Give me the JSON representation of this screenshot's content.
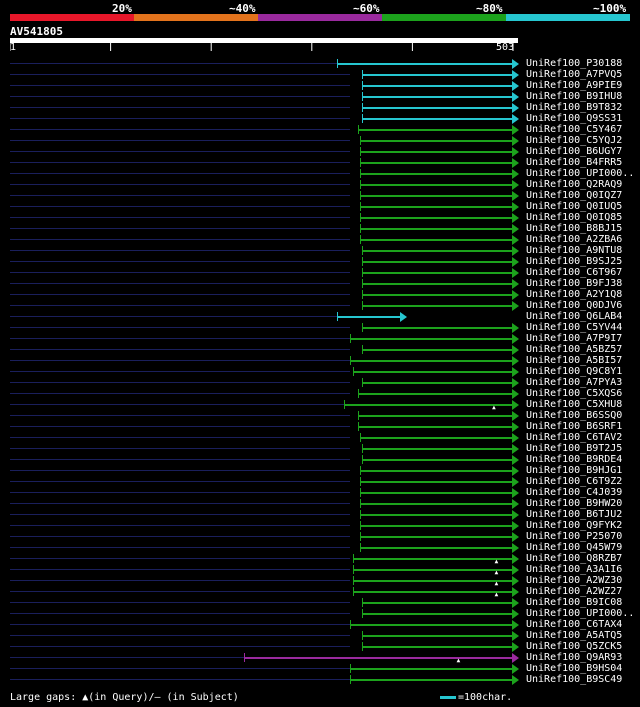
{
  "identity_legend": {
    "labels": [
      "20%",
      "~40%",
      "~60%",
      "~80%",
      "~100%"
    ],
    "colors": [
      "#e8172a",
      "#e3731c",
      "#9a2a9e",
      "#1ca21c",
      "#26c6d0"
    ]
  },
  "query": {
    "name": "AV541805",
    "start": "1",
    "end": "503"
  },
  "hits": [
    {
      "id": "UniRef100_P30188",
      "start": 0.643,
      "color": "#26c6d0"
    },
    {
      "id": "UniRef100_A7PVQ5",
      "start": 0.693,
      "color": "#26c6d0"
    },
    {
      "id": "UniRef100_A9PIE9",
      "start": 0.693,
      "color": "#26c6d0"
    },
    {
      "id": "UniRef100_B9IHU8",
      "start": 0.693,
      "color": "#26c6d0"
    },
    {
      "id": "UniRef100_B9T832",
      "start": 0.693,
      "color": "#26c6d0"
    },
    {
      "id": "UniRef100_Q9SS31",
      "start": 0.693,
      "color": "#26c6d0"
    },
    {
      "id": "UniRef100_C5Y467",
      "start": 0.685,
      "color": "#1ca21c"
    },
    {
      "id": "UniRef100_C5YQJ2",
      "start": 0.688,
      "color": "#1ca21c"
    },
    {
      "id": "UniRef100_B6UGY7",
      "start": 0.688,
      "color": "#1ca21c"
    },
    {
      "id": "UniRef100_B4FRR5",
      "start": 0.688,
      "color": "#1ca21c"
    },
    {
      "id": "UniRef100_UPI000..",
      "start": 0.688,
      "color": "#1ca21c"
    },
    {
      "id": "UniRef100_Q2RAQ9",
      "start": 0.688,
      "color": "#1ca21c"
    },
    {
      "id": "UniRef100_Q0IQZ7",
      "start": 0.688,
      "color": "#1ca21c"
    },
    {
      "id": "UniRef100_Q0IUQ5",
      "start": 0.688,
      "color": "#1ca21c"
    },
    {
      "id": "UniRef100_Q0IQ85",
      "start": 0.688,
      "color": "#1ca21c"
    },
    {
      "id": "UniRef100_B8BJ15",
      "start": 0.688,
      "color": "#1ca21c"
    },
    {
      "id": "UniRef100_A2ZBA6",
      "start": 0.688,
      "color": "#1ca21c"
    },
    {
      "id": "UniRef100_A9NTU8",
      "start": 0.693,
      "color": "#1ca21c"
    },
    {
      "id": "UniRef100_B9SJ25",
      "start": 0.693,
      "color": "#1ca21c"
    },
    {
      "id": "UniRef100_C6T967",
      "start": 0.693,
      "color": "#1ca21c"
    },
    {
      "id": "UniRef100_B9FJ38",
      "start": 0.693,
      "color": "#1ca21c"
    },
    {
      "id": "UniRef100_A2Y1Q8",
      "start": 0.693,
      "color": "#1ca21c"
    },
    {
      "id": "UniRef100_Q0DJV6",
      "start": 0.693,
      "color": "#1ca21c"
    },
    {
      "id": "UniRef100_Q6LAB4",
      "start": 0.643,
      "end": 0.78,
      "color": "#26c6d0"
    },
    {
      "id": "UniRef100_C5YV44",
      "start": 0.693,
      "color": "#1ca21c"
    },
    {
      "id": "UniRef100_A7P9I7",
      "start": 0.67,
      "color": "#1ca21c"
    },
    {
      "id": "UniRef100_A5BZ57",
      "start": 0.693,
      "color": "#1ca21c"
    },
    {
      "id": "UniRef100_A5BI57",
      "start": 0.67,
      "color": "#1ca21c"
    },
    {
      "id": "UniRef100_Q9C8Y1",
      "start": 0.675,
      "color": "#1ca21c"
    },
    {
      "id": "UniRef100_A7PYA3",
      "start": 0.693,
      "color": "#1ca21c"
    },
    {
      "id": "UniRef100_C5XQS6",
      "start": 0.685,
      "color": "#1ca21c"
    },
    {
      "id": "UniRef100_C5XHU8",
      "start": 0.658,
      "color": "#1ca21c",
      "gap": 0.955
    },
    {
      "id": "UniRef100_B6SSQ0",
      "start": 0.685,
      "color": "#1ca21c"
    },
    {
      "id": "UniRef100_B6SRF1",
      "start": 0.685,
      "color": "#1ca21c"
    },
    {
      "id": "UniRef100_C6TAV2",
      "start": 0.688,
      "color": "#1ca21c"
    },
    {
      "id": "UniRef100_B9T2J5",
      "start": 0.693,
      "color": "#1ca21c"
    },
    {
      "id": "UniRef100_B9RDE4",
      "start": 0.693,
      "color": "#1ca21c"
    },
    {
      "id": "UniRef100_B9HJG1",
      "start": 0.688,
      "color": "#1ca21c"
    },
    {
      "id": "UniRef100_C6T9Z2",
      "start": 0.688,
      "color": "#1ca21c"
    },
    {
      "id": "UniRef100_C4J039",
      "start": 0.688,
      "color": "#1ca21c"
    },
    {
      "id": "UniRef100_B9HW20",
      "start": 0.688,
      "color": "#1ca21c"
    },
    {
      "id": "UniRef100_B6TJU2",
      "start": 0.688,
      "color": "#1ca21c"
    },
    {
      "id": "UniRef100_Q9FYK2",
      "start": 0.688,
      "color": "#1ca21c"
    },
    {
      "id": "UniRef100_P25070",
      "start": 0.688,
      "color": "#1ca21c"
    },
    {
      "id": "UniRef100_Q45W79",
      "start": 0.688,
      "color": "#1ca21c"
    },
    {
      "id": "UniRef100_Q8RZB7",
      "start": 0.675,
      "color": "#1ca21c",
      "gap": 0.96
    },
    {
      "id": "UniRef100_A3A1I6",
      "start": 0.675,
      "color": "#1ca21c",
      "gap": 0.96
    },
    {
      "id": "UniRef100_A2WZ30",
      "start": 0.675,
      "color": "#1ca21c",
      "gap": 0.96
    },
    {
      "id": "UniRef100_A2WZ27",
      "start": 0.675,
      "color": "#1ca21c",
      "gap": 0.96
    },
    {
      "id": "UniRef100_B9IC08",
      "start": 0.693,
      "color": "#1ca21c"
    },
    {
      "id": "UniRef100_UPI000..",
      "start": 0.693,
      "color": "#1ca21c"
    },
    {
      "id": "UniRef100_C6TAX4",
      "start": 0.67,
      "color": "#1ca21c"
    },
    {
      "id": "UniRef100_A5ATQ5",
      "start": 0.693,
      "color": "#1ca21c"
    },
    {
      "id": "UniRef100_Q5ZCK5",
      "start": 0.693,
      "color": "#1ca21c"
    },
    {
      "id": "UniRef100_Q9AR93",
      "start": 0.46,
      "color": "#9a2a9e",
      "gap": 0.885
    },
    {
      "id": "UniRef100_B9HS04",
      "start": 0.67,
      "color": "#1ca21c"
    },
    {
      "id": "UniRef100_B9SC49",
      "start": 0.67,
      "color": "#1ca21c"
    }
  ],
  "footer": {
    "gaps_legend": "Large gaps: ▲(in Query)/– (in Subject)",
    "scale_label": "=100char."
  }
}
